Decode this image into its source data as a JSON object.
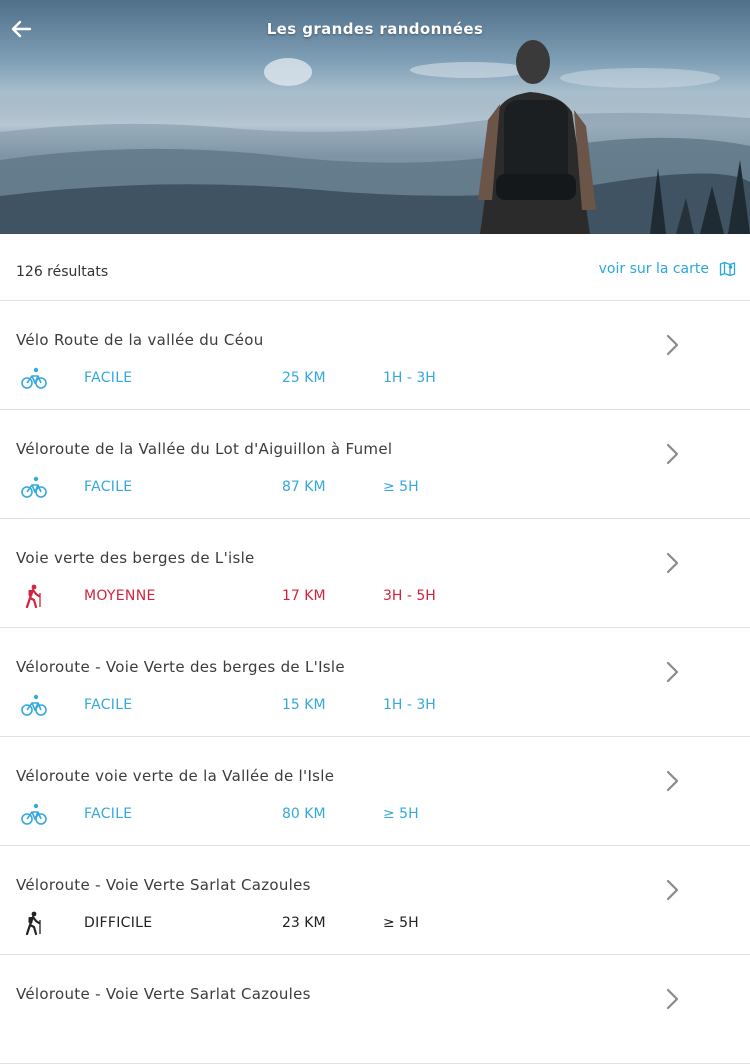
{
  "header": {
    "title": "Les grandes randonnées",
    "back_icon": "arrow-left-icon"
  },
  "results": {
    "count_label": "126 résultats",
    "map_link_label": "voir sur la carte",
    "map_icon": "map-icon"
  },
  "colors": {
    "easy": "#35a8dc",
    "medium": "#d4233c",
    "hard": "#222222",
    "link": "#2aa7dc"
  },
  "routes": [
    {
      "title": "Vélo Route de la vallée du Céou",
      "activity_icon": "bicycle-icon",
      "level": "FACILE",
      "distance": "25 KM",
      "duration": "1H - 3H",
      "color": "#35a8dc"
    },
    {
      "title": "Véloroute de la Vallée du Lot d'Aiguillon à Fumel",
      "activity_icon": "bicycle-icon",
      "level": "FACILE",
      "distance": "87 KM",
      "duration": "≥ 5H",
      "color": "#35a8dc"
    },
    {
      "title": "Voie verte des berges de L'isle",
      "activity_icon": "hiker-icon",
      "level": "MOYENNE",
      "distance": "17 KM",
      "duration": "3H - 5H",
      "color": "#d4233c"
    },
    {
      "title": "Véloroute - Voie Verte des berges de L'Isle",
      "activity_icon": "bicycle-icon",
      "level": "FACILE",
      "distance": "15 KM",
      "duration": "1H - 3H",
      "color": "#35a8dc"
    },
    {
      "title": "Véloroute voie verte de la Vallée de l'Isle",
      "activity_icon": "bicycle-icon",
      "level": "FACILE",
      "distance": "80 KM",
      "duration": "≥ 5H",
      "color": "#35a8dc"
    },
    {
      "title": "Véloroute - Voie Verte Sarlat Cazoules",
      "activity_icon": "hiker-icon",
      "level": "DIFFICILE",
      "distance": "23 KM",
      "duration": "≥ 5H",
      "color": "#222222"
    },
    {
      "title": "Véloroute - Voie Verte Sarlat Cazoules",
      "activity_icon": "hiker-icon",
      "level": "",
      "distance": "",
      "duration": "",
      "color": "#222222"
    }
  ]
}
